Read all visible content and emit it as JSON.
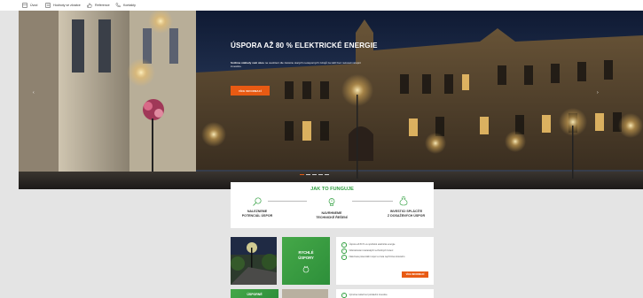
{
  "nav": {
    "items": [
      {
        "label": "Úvod",
        "icon": "home-icon"
      },
      {
        "label": "Hodnoty ve zkratce",
        "icon": "list-icon"
      },
      {
        "label": "Reference",
        "icon": "thumbs-up-icon"
      },
      {
        "label": "Kontakty",
        "icon": "phone-icon"
      }
    ]
  },
  "hero": {
    "title": "ÚSPORA AŽ 80 % ELEKTRICKÉ ENERGIE",
    "subtitle_bold": "Snížíme náklady vaší obce",
    "subtitle_rest": " na osvětlení dle záměnu starých neúsporných zdrojů za LED bez nutnosti vstupní investice.",
    "button": "VÍCE INFORMACÍ",
    "arrow_left": "‹",
    "arrow_right": "›",
    "slides": 5,
    "active_slide": 1
  },
  "how": {
    "title": "JAK TO FUNGUJE",
    "steps": [
      {
        "line1": "NALEZNEME",
        "line2": "POTENCIÁL ÚSPOR",
        "icon": "magnifier-icon"
      },
      {
        "line1": "NAVRHNEME",
        "line2": "TECHNICKÉ ŘEŠENÍ",
        "icon": "lightbulb-icon"
      },
      {
        "line1": "INVESTICI SPLÁCÍTE",
        "line2": "Z DOSAŽENÝCH ÚSPOR",
        "icon": "money-bag-icon"
      }
    ]
  },
  "cards": [
    {
      "tile_line1": "RYCHLÉ",
      "tile_line2": "ÚSPORY",
      "tile_icon": "savings-icon",
      "bullets": [
        "Úspora až 80 % ve spotřebě elektrické energie",
        "Odstraňování zastaralých technických řešení",
        "Naleznete potenciální úspor a zcela nepříznivé krásného"
      ],
      "button": "VÍCE INFORMACÍ"
    },
    {
      "tile_line1": "ÚSPORNÉ",
      "tile_line2": "",
      "tile_icon": "",
      "bullets": [
        "Výměna světel bez počáteční investice"
      ],
      "button": ""
    }
  ],
  "colors": {
    "accent_orange": "#e85a13",
    "accent_green": "#32a041",
    "page_bg": "#e4e4e4"
  }
}
